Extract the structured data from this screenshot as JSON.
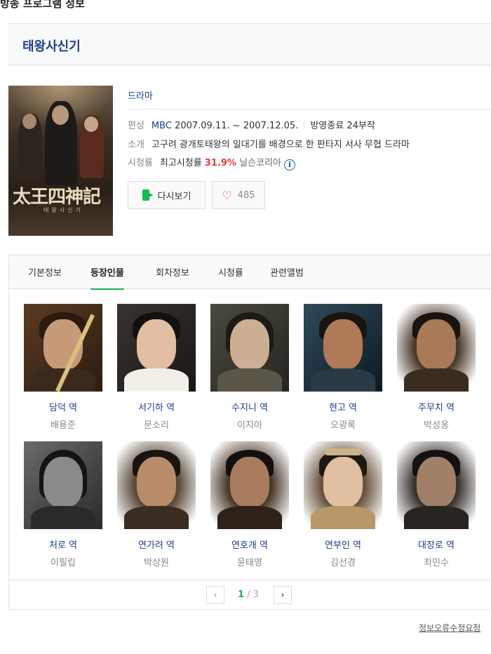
{
  "page": {
    "section_title": "방송 프로그램 정보",
    "program_title": "태왕사신기",
    "report_link": "정보오류수정요청"
  },
  "poster": {
    "hanja": "太王四神記",
    "subtitle": "태왕사신기"
  },
  "info": {
    "genre": "드라마",
    "broadcast_label": "편성",
    "channel": "MBC",
    "period": "2007.09.11. ~ 2007.12.05.",
    "status": "방영종료 24부작",
    "intro_label": "소개",
    "intro": "고구려 광개토태왕의 일대기를 배경으로 한 판타지 서사 무협 드라마",
    "rating_label": "시청률",
    "rating_prefix": "최고시청률",
    "rating_value": "31.9%",
    "rating_source": "닐슨코리아",
    "info_icon_glyph": "i"
  },
  "buttons": {
    "replay": "다시보기",
    "like_count": "485"
  },
  "tabs": [
    {
      "label": "기본정보"
    },
    {
      "label": "등장인물"
    },
    {
      "label": "회차정보"
    },
    {
      "label": "시청률"
    },
    {
      "label": "관련앨범"
    }
  ],
  "cast": [
    {
      "role": "담덕",
      "suffix": "역",
      "actor": "배용준"
    },
    {
      "role": "서기하",
      "suffix": "역",
      "actor": "문소리"
    },
    {
      "role": "수지니",
      "suffix": "역",
      "actor": "이지아"
    },
    {
      "role": "현고",
      "suffix": "역",
      "actor": "오광록"
    },
    {
      "role": "주무치",
      "suffix": "역",
      "actor": "박성웅"
    },
    {
      "role": "처로",
      "suffix": "역",
      "actor": "이필립"
    },
    {
      "role": "연가려",
      "suffix": "역",
      "actor": "박상원"
    },
    {
      "role": "연호개",
      "suffix": "역",
      "actor": "윤태영"
    },
    {
      "role": "연부인",
      "suffix": "역",
      "actor": "김선경"
    },
    {
      "role": "대장로",
      "suffix": "역",
      "actor": "최민수"
    }
  ],
  "pagination": {
    "current": "1",
    "separator": "/",
    "total": "3",
    "prev_glyph": "‹",
    "next_glyph": "›"
  },
  "colors": {
    "accent_green": "#17b84f",
    "link_blue": "#1a3f8c",
    "rating_red": "#e53e3e"
  }
}
